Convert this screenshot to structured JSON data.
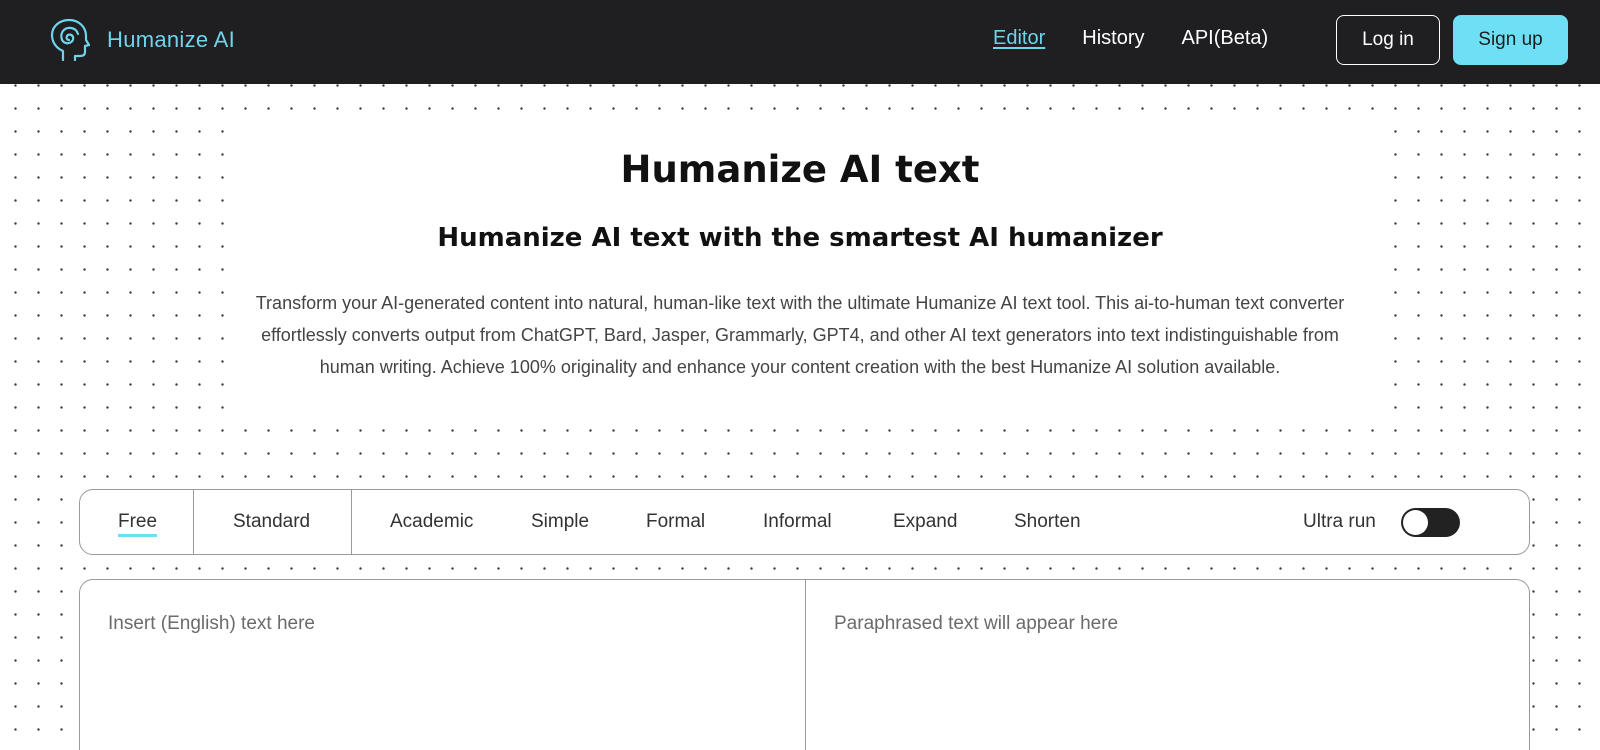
{
  "header": {
    "brand_name": "Humanize AI",
    "logo_icon": "head-spiral-icon",
    "nav": [
      {
        "label": "Editor",
        "active": true
      },
      {
        "label": "History",
        "active": false
      },
      {
        "label": "API(Beta)",
        "active": false
      }
    ],
    "login_label": "Log in",
    "signup_label": "Sign up"
  },
  "hero": {
    "title": "Humanize AI text",
    "subtitle": "Humanize AI text with the smartest AI humanizer",
    "description": "Transform your AI-generated content into natural, human-like text with the ultimate Humanize AI text tool. This ai-to-human text converter effortlessly converts output from ChatGPT, Bard, Jasper, Grammarly, GPT4, and other AI text generators into text indistinguishable from human writing. Achieve 100% originality and enhance your content creation with the best Humanize AI solution available."
  },
  "modes": {
    "items": [
      {
        "label": "Free",
        "active": true
      },
      {
        "label": "Standard",
        "active": false
      },
      {
        "label": "Academic",
        "active": false
      },
      {
        "label": "Simple",
        "active": false
      },
      {
        "label": "Formal",
        "active": false
      },
      {
        "label": "Informal",
        "active": false
      },
      {
        "label": "Expand",
        "active": false
      },
      {
        "label": "Shorten",
        "active": false
      }
    ],
    "ultra_run_label": "Ultra run",
    "ultra_run_on": false
  },
  "editor": {
    "input_value": "",
    "input_placeholder": "Insert (English) text here",
    "output_placeholder": "Paraphrased text will appear here"
  },
  "colors": {
    "header_bg": "#1f1e21",
    "accent": "#6ee0f6",
    "brand_text": "#6fd3ea"
  }
}
